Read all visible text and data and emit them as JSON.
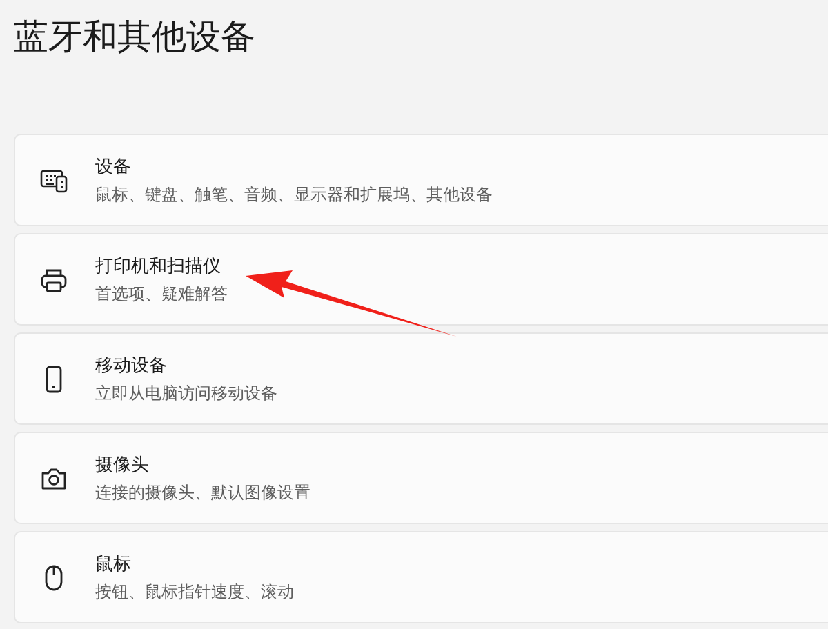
{
  "page_title": "蓝牙和其他设备",
  "items": [
    {
      "kind": "keyboard",
      "title": "设备",
      "subtitle": "鼠标、键盘、触笔、音频、显示器和扩展坞、其他设备"
    },
    {
      "kind": "printer",
      "title": "打印机和扫描仪",
      "subtitle": "首选项、疑难解答"
    },
    {
      "kind": "phone",
      "title": "移动设备",
      "subtitle": "立即从电脑访问移动设备"
    },
    {
      "kind": "camera",
      "title": "摄像头",
      "subtitle": "连接的摄像头、默认图像设置"
    },
    {
      "kind": "mouse",
      "title": "鼠标",
      "subtitle": "按钮、鼠标指针速度、滚动"
    }
  ]
}
